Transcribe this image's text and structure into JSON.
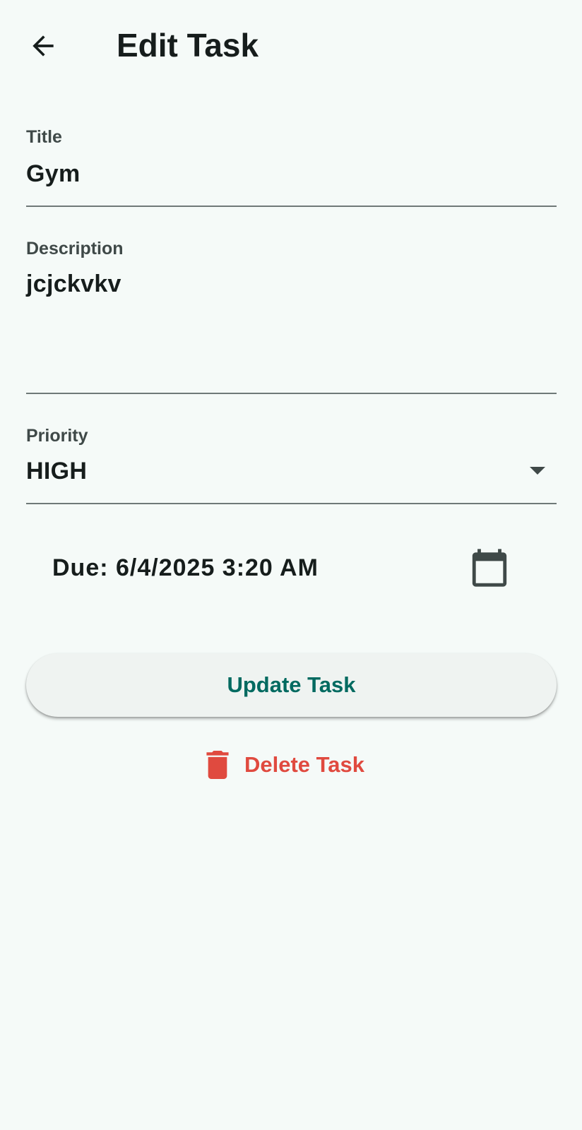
{
  "app_bar": {
    "title": "Edit Task",
    "back_icon": "arrow-back-icon"
  },
  "form": {
    "title_field": {
      "label": "Title",
      "value": "Gym"
    },
    "description_field": {
      "label": "Description",
      "value": "jcjckvkv"
    },
    "priority_field": {
      "label": "Priority",
      "value": "HIGH",
      "icon": "arrow-drop-down-icon"
    },
    "due": {
      "text": "Due: 6/4/2025 3:20 AM",
      "icon": "calendar-icon"
    }
  },
  "actions": {
    "update_label": "Update Task",
    "delete_label": "Delete Task",
    "delete_icon": "trash-icon"
  },
  "colors": {
    "background": "#f5faf8",
    "primary": "#006a60",
    "error": "#e04a3f",
    "underline": "#6f7978"
  }
}
